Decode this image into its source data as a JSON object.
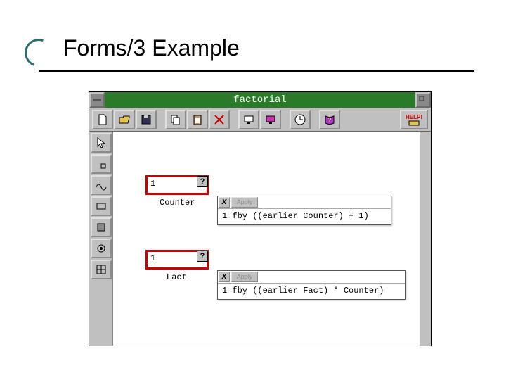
{
  "slide": {
    "title": "Forms/3 Example"
  },
  "window": {
    "title": "factorial",
    "help_label": "HELP!"
  },
  "toolbar": {
    "icons": [
      "new",
      "open",
      "save",
      "copy",
      "paste",
      "cut",
      "view1",
      "view2",
      "clock",
      "help-book"
    ]
  },
  "cells": {
    "counter": {
      "value": "1",
      "label": "Counter"
    },
    "fact": {
      "value": "1",
      "label": "Fact"
    }
  },
  "formulas": {
    "apply_label": "Apply",
    "x_label": "X",
    "counter": "1 fby ((earlier Counter) + 1)",
    "fact": "1 fby ((earlier Fact) * Counter)"
  }
}
